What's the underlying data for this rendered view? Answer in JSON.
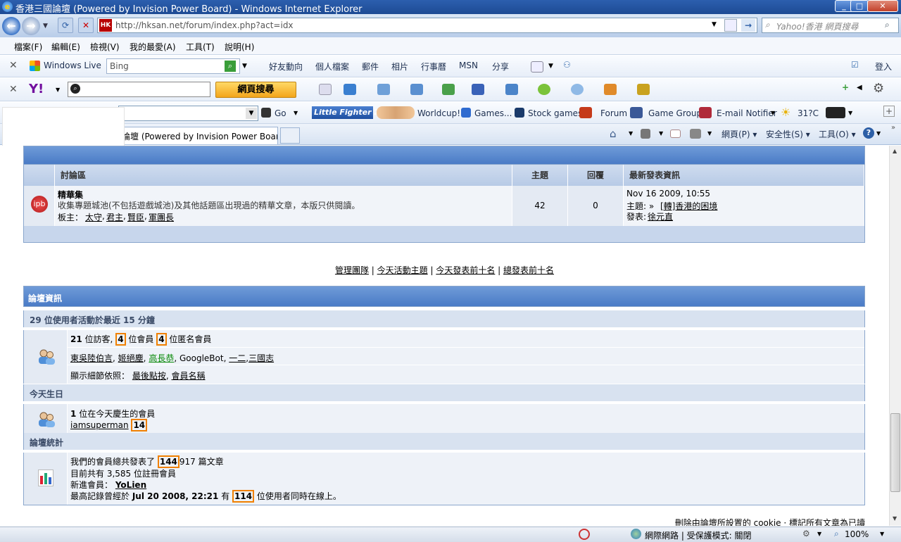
{
  "window": {
    "title": "香港三國論壇 (Powered by Invision Power Board) - Windows Internet Explorer",
    "url": "http://hksan.net/forum/index.php?act=idx",
    "favicon_text": "HK",
    "search_placeholder": "Yahoo!香港 網頁搜尋"
  },
  "menu": [
    "檔案(F)",
    "編輯(E)",
    "檢視(V)",
    "我的最愛(A)",
    "工具(T)",
    "說明(H)"
  ],
  "live_toolbar": {
    "brand": "Windows Live",
    "search_value": "Bing",
    "links": [
      "好友動向",
      "個人檔案",
      "郵件",
      "相片",
      "行事曆",
      "MSN",
      "分享"
    ],
    "signin": "登入"
  },
  "yahoo_toolbar": {
    "search_button": "網頁搜尋"
  },
  "links_toolbar": {
    "go": "Go",
    "items": [
      "Worldcup!",
      "Games...",
      "Stock games",
      "Forum",
      "Game Group",
      "E-mail Notifier",
      "31?C"
    ],
    "little_fighter": "Little Fighter 2"
  },
  "tab": {
    "label": "論壇 (Powered by Invision Power Boar..."
  },
  "command_bar": {
    "page": "網頁(P)",
    "safety": "安全性(S)",
    "tools": "工具(O)"
  },
  "forum_table": {
    "headers": [
      "討論區",
      "主題",
      "回覆",
      "最新發表資訊"
    ],
    "row": {
      "icon": "ipb",
      "name": "精華集",
      "desc": "收集專題城池(不包括遊戲城池)及其他話題區出現過的精華文章，本版只供閱讀。",
      "mods_label": "板主：",
      "mods": [
        "太守",
        "君主",
        "賢臣",
        "軍團長"
      ],
      "topics": "42",
      "replies": "0",
      "last_date": "Nov 16 2009, 10:55",
      "last_topic_label": "主題: »",
      "last_topic": "[轉]香港的困境",
      "last_poster_label": "發表:",
      "last_poster": "徐元直"
    }
  },
  "links_row": [
    "管理團隊",
    "今天活動主題",
    "今天發表前十名",
    "總發表前十名"
  ],
  "info": {
    "title": "論壇資訊",
    "active_header": "29 位使用者活動於最近 15 分鐘",
    "guests": "21",
    "guests_text": "位訪客,",
    "members": "4",
    "members_text": "位會員",
    "anon": "4",
    "anon_text": "位匿名會員",
    "active_users": [
      "東吳陸伯言",
      "姬絕塵",
      "高長恭",
      "GoogleBot",
      "一二",
      "三國志"
    ],
    "sort_label": "顯示細節依照：",
    "sort_options": [
      "最後點按",
      "會員名稱"
    ],
    "birthday_header": "今天生日",
    "birthday_count": "1",
    "birthday_text": "位在今天慶生的會員",
    "birthday_user": "iamsuperman",
    "birthday_age": "14",
    "stats_header": "論壇統計",
    "posts_prefix": "我們的會員總共發表了",
    "posts_hl": "144",
    "posts_rest": "917 篇文章",
    "registered": "目前共有 3,585 位註冊會員",
    "newest_label": "新進會員：",
    "newest_user": "YoLien",
    "record_prefix": "最高記錄曾經於",
    "record_date": "Jul 20 2008, 22:21",
    "record_mid": "有",
    "record_hl": "114",
    "record_suffix": "位使用者同時在線上。"
  },
  "footer_links": "刪除由論壇所設置的 cookie · 標記所有文章為已讀",
  "statusbar": {
    "zone": "網際網路 | 受保護模式: 關閉",
    "zoom": "100%"
  }
}
